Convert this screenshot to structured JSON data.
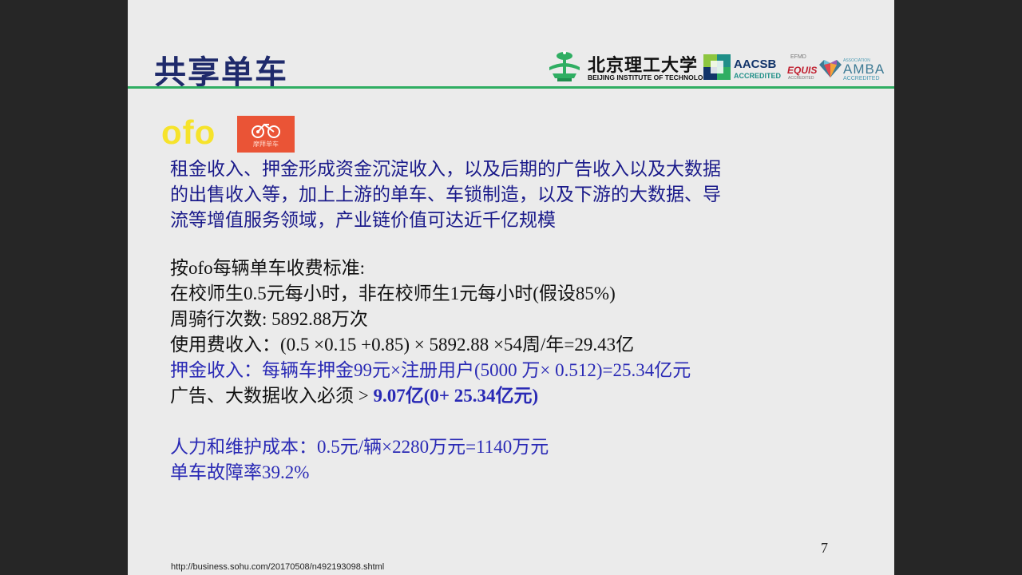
{
  "slide": {
    "title": "共享单车",
    "page_number": "7",
    "source_url": "http://business.sohu.com/20170508/n492193098.shtml"
  },
  "logos": {
    "bit_cn": "北京理工大学",
    "bit_en": "BEIJING INSTITUTE OF TECHNOLOGY",
    "aacsb_name": "AACSB",
    "aacsb_sub": "ACCREDITED",
    "efmd": "EFMD",
    "equis": "EQUIS",
    "equis_sub": "ACCREDITED",
    "amba_assoc": "ASSOCIATION",
    "amba_name": "AMBA",
    "amba_sub": "ACCREDITED",
    "ofo": "ofo",
    "mobike": "摩拜单车"
  },
  "paragraph": [
    "租金收入、押金形成资金沉淀收入，以及后期的广告收入以及大数据",
    "的出售收入等，加上上游的单车、车锁制造，以及下游的大数据、导",
    "流等增值服务领域，产业链价值可达近千亿规模"
  ],
  "calc": {
    "line1": "按ofo每辆单车收费标准:",
    "line2": "在校师生0.5元每小时，非在校师生1元每小时(假设85%)",
    "line3": "周骑行次数: 5892.88万次",
    "line4": "使用费收入：(0.5 ×0.15 +0.85) × 5892.88 ×54周/年=29.43亿",
    "line5": "押金收入：每辆车押金99元×注册用户(5000 万× 0.512)=25.34亿元",
    "line6_prefix": "广告、大数据收入必须 > ",
    "line6_bold": "9.07亿(0+ 25.34亿元)",
    "line7": "人力和维护成本：0.5元/辆×2280万元=1140万元",
    "line8": "单车故障率39.2%"
  },
  "colors": {
    "title": "#1f2a6b",
    "rule": "#2fae62",
    "paragraph": "#1a1a8a",
    "highlight": "#2a2ab5",
    "ofo_yellow": "#f6e32b",
    "mobike_orange": "#ea5436"
  }
}
